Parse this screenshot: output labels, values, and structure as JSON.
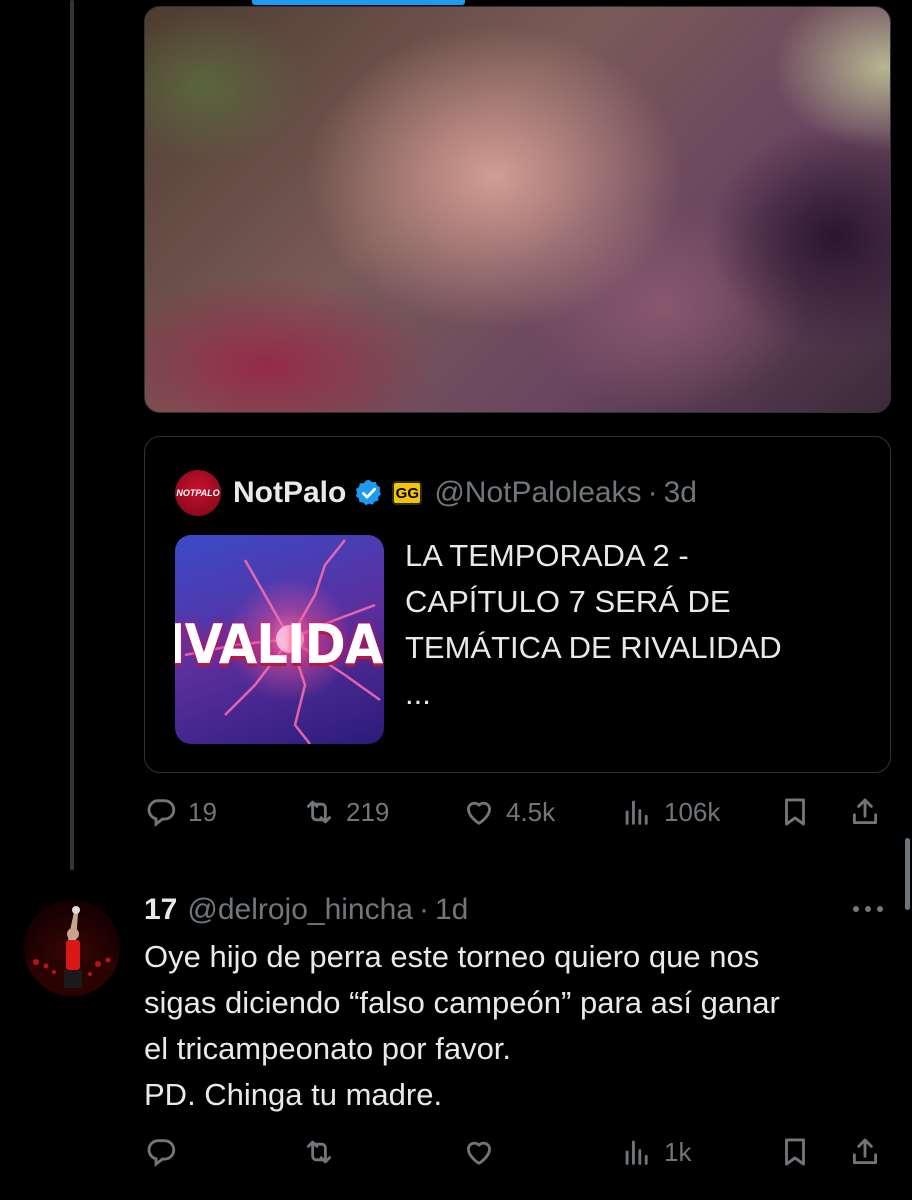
{
  "quoted_tweet": {
    "avatar_text": "NOTPALO",
    "name": "NotPalo",
    "badge_text": "GG",
    "handle": "@NotPaloleaks",
    "separator": "·",
    "time": "3d",
    "thumbnail_text": "IVALIDA",
    "text_lines": [
      "LA TEMPORADA 2 -",
      "CAPÍTULO 7 SERÁ DE",
      "TEMÁTICA DE RIVALIDAD",
      "..."
    ]
  },
  "main_actions": {
    "replies": "19",
    "reposts": "219",
    "likes": "4.5k",
    "views": "106k"
  },
  "reply": {
    "name": "17",
    "handle": "@delrojo_hincha",
    "separator": "·",
    "time": "1d",
    "text_lines": [
      "Oye hijo de perra este torneo quiero que nos",
      "sigas diciendo “falso campeón” para así ganar",
      "el tricampeonato por favor.",
      "PD. Chinga tu madre."
    ],
    "views": "1k"
  },
  "colors": {
    "background": "#000000",
    "text": "#e7e9ea",
    "muted": "#71767b",
    "accent": "#1d9bf0",
    "border": "#2f3336"
  },
  "icons": [
    "reply-icon",
    "repost-icon",
    "like-icon",
    "views-icon",
    "bookmark-icon",
    "share-icon",
    "verified-icon",
    "more-icon"
  ]
}
